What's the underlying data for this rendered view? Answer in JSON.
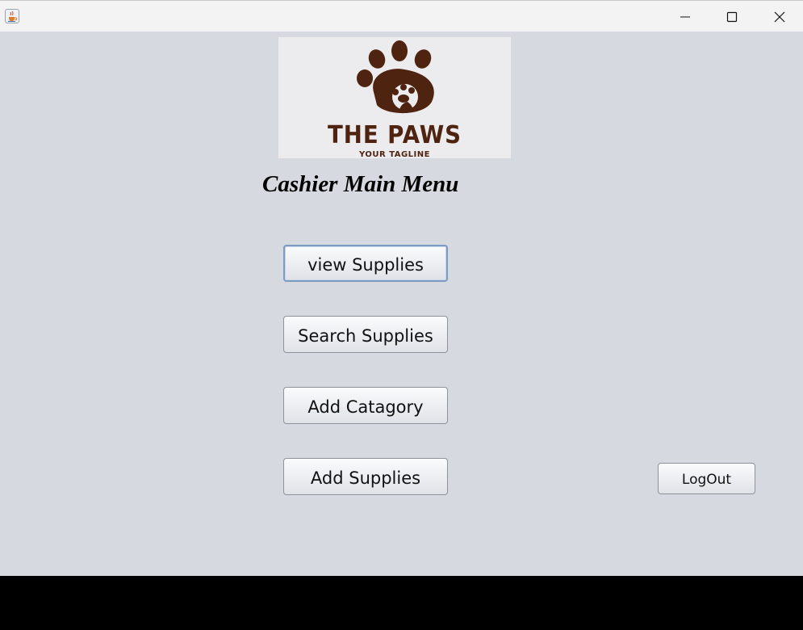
{
  "window": {
    "app_icon": "java-cup-icon",
    "controls": [
      "minimize-icon",
      "maximize-icon",
      "close-icon"
    ]
  },
  "logo": {
    "title": "THE PAWS",
    "tagline": "YOUR TAGLINE",
    "color": "#4e2410"
  },
  "page": {
    "title": "Cashier Main Menu"
  },
  "menu": {
    "view_supplies": "view Supplies",
    "search_supplies": "Search Supplies",
    "add_category": "Add Catagory",
    "add_supplies": "Add Supplies",
    "logout": "LogOut"
  },
  "colors": {
    "background": "#d6d9e0",
    "focus_border": "#7b9ac4"
  }
}
